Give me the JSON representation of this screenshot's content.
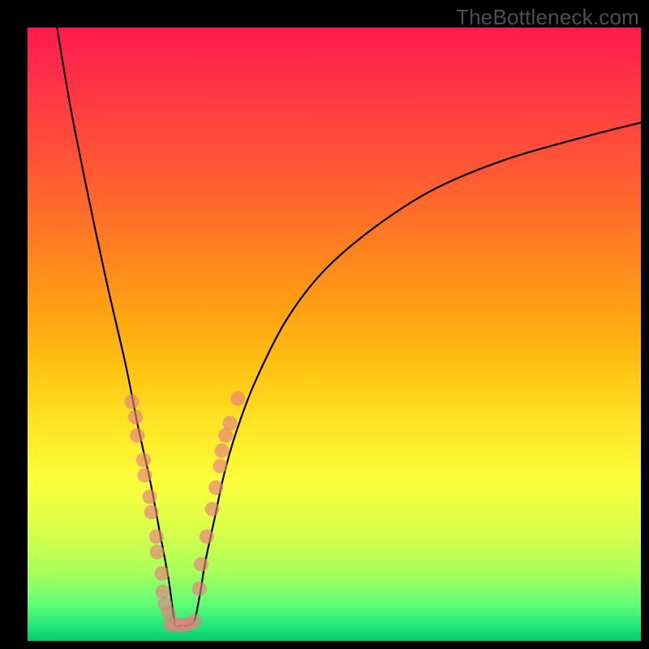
{
  "watermark": "TheBottleneck.com",
  "colors": {
    "background": "#000000",
    "curve": "#000000",
    "dot": "#e58080"
  },
  "chart_data": {
    "type": "line",
    "title": "",
    "xlabel": "",
    "ylabel": "",
    "xlim": [
      0,
      100
    ],
    "ylim": [
      0,
      100
    ],
    "grid": false,
    "legend": false,
    "note": "Axis values are approximate percentages of plot width/height inferred from pixel positions; the underlying curve shape resembles an absolute-value / V-shaped bottleneck function with rounded minimum near x≈24.",
    "series": [
      {
        "name": "bottleneck-curve",
        "x": [
          4.8,
          7,
          10,
          13,
          16,
          18,
          20,
          21.5,
          23,
          24,
          25,
          27,
          28,
          29,
          30.5,
          32,
          34,
          37,
          42,
          48,
          56,
          66,
          78,
          92,
          100
        ],
        "y": [
          100,
          87,
          72,
          58,
          45,
          35,
          26,
          18,
          10,
          3,
          2.5,
          3,
          7,
          13,
          20,
          27,
          34,
          42,
          52,
          60,
          67,
          73.5,
          78.5,
          82.5,
          84.5
        ]
      },
      {
        "name": "left-cluster-dots",
        "type": "scatter",
        "x": [
          17.0,
          17.6,
          17.9,
          18.9,
          19.1,
          19.9,
          20.2,
          21.0,
          21.1,
          21.9,
          22.0,
          22.4,
          23.0
        ],
        "y": [
          39.0,
          36.5,
          33.5,
          29.5,
          27.0,
          23.5,
          21.0,
          17.0,
          14.5,
          11.0,
          8.0,
          6.0,
          4.5
        ]
      },
      {
        "name": "right-cluster-dots",
        "type": "scatter",
        "x": [
          28.0,
          28.3,
          29.2,
          30.1,
          30.7,
          31.4,
          31.7,
          32.3,
          33.0,
          34.3
        ],
        "y": [
          8.5,
          12.5,
          17.0,
          21.5,
          25.0,
          28.5,
          31.0,
          33.5,
          35.5,
          39.5
        ]
      },
      {
        "name": "bottom-cluster-dots",
        "type": "scatter",
        "x": [
          23.3,
          24.2,
          25.3,
          26.2,
          27.2
        ],
        "y": [
          2.7,
          2.6,
          2.6,
          2.7,
          3.2
        ]
      }
    ]
  }
}
